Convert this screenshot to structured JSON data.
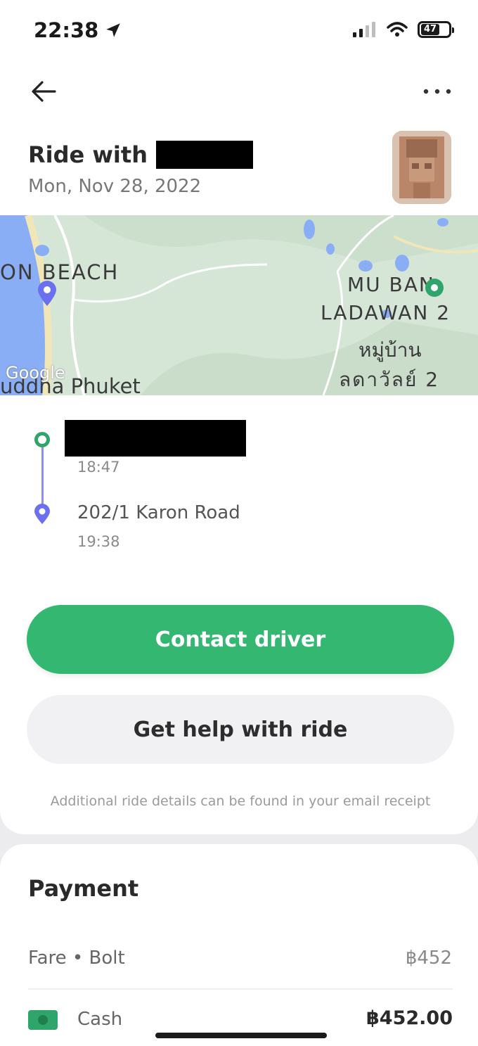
{
  "status_bar": {
    "time": "22:38",
    "battery": "47"
  },
  "header": {
    "title_prefix": "Ride with",
    "date": "Mon, Nov 28, 2022"
  },
  "map": {
    "label_beach": "ON BEACH",
    "label_mu_ban": "MU BAN",
    "label_ladawan": "LADAWAN 2",
    "label_thai_line1": "หมู่บ้าน",
    "label_thai_line2": "ลดาวัลย์ 2",
    "label_city": "uddha Phuket",
    "watermark": "Google"
  },
  "route": {
    "pickup_time": "18:47",
    "dropoff_address": "202/1 Karon Road",
    "dropoff_time": "19:38"
  },
  "actions": {
    "contact_label": "Contact driver",
    "help_label": "Get help with ride"
  },
  "note": "Additional ride details can be found in your email receipt",
  "payment": {
    "title": "Payment",
    "fare_label": "Fare • Bolt",
    "fare_value": "฿452",
    "method_label": "Cash",
    "method_value": "฿452.00"
  },
  "colors": {
    "accent_green": "#33b771",
    "route_blue": "#6a70f0"
  }
}
